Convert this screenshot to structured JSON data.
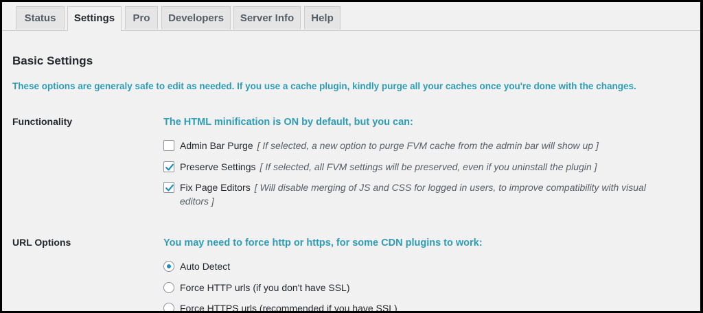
{
  "tabs": [
    "Status",
    "Settings",
    "Pro",
    "Developers",
    "Server Info",
    "Help"
  ],
  "basic": {
    "heading": "Basic Settings",
    "intro": "These options are generaly safe to edit as needed. If you use a cache plugin, kindly purge all your caches once you're done with the changes."
  },
  "functionality": {
    "label": "Functionality",
    "heading": "The HTML minification is ON by default, but you can:",
    "options": [
      {
        "label": "Admin Bar Purge",
        "hint": "[ If selected, a new option to purge FVM cache from the admin bar will show up ]",
        "checked": false
      },
      {
        "label": "Preserve Settings",
        "hint": "[ If selected, all FVM settings will be preserved, even if you uninstall the plugin ]",
        "checked": true
      },
      {
        "label": "Fix Page Editors",
        "hint": "[ Will disable merging of JS and CSS for logged in users, to improve compatibility with visual editors ]",
        "checked": true
      }
    ]
  },
  "url_options": {
    "label": "URL Options",
    "heading": "You may need to force http or https, for some CDN plugins to work:",
    "options": [
      {
        "label": "Auto Detect",
        "selected": true
      },
      {
        "label": "Force HTTP urls (if you don't have SSL)",
        "selected": false
      },
      {
        "label": "Force HTTPS urls (recommended if you have SSL)",
        "selected": false
      }
    ]
  },
  "colors": {
    "accent": "#2e9cb3",
    "checkmark": "#1e8cbe"
  }
}
